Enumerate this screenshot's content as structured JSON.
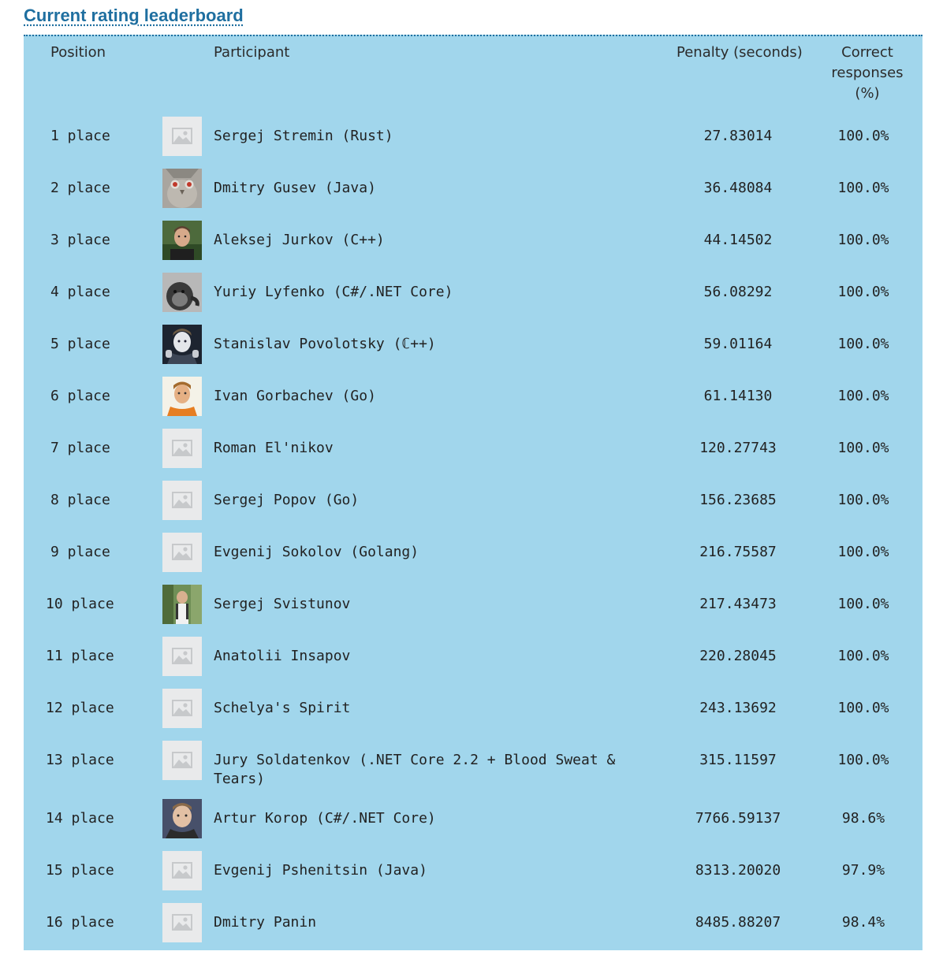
{
  "title": "Current rating leaderboard",
  "columns": {
    "position": "Position",
    "participant": "Participant",
    "penalty": "Penalty (seconds)",
    "correct_l1": "Correct",
    "correct_l2": "responses",
    "correct_l3": "(%)"
  },
  "rows": [
    {
      "position": "1 place",
      "name": "Sergej Stremin (Rust)",
      "penalty": "27.83014",
      "correct": "100.0%",
      "avatar": "placeholder"
    },
    {
      "position": "2 place",
      "name": "Dmitry Gusev (Java)",
      "penalty": "36.48084",
      "correct": "100.0%",
      "avatar": "owl"
    },
    {
      "position": "3 place",
      "name": "Aleksej Jurkov (C++)",
      "penalty": "44.14502",
      "correct": "100.0%",
      "avatar": "man-outdoor"
    },
    {
      "position": "4 place",
      "name": "Yuriy Lyfenko (C#/.NET Core)",
      "penalty": "56.08292",
      "correct": "100.0%",
      "avatar": "monkey"
    },
    {
      "position": "5 place",
      "name": "Stanislav Povolotsky (ℂ++)",
      "penalty": "59.01164",
      "correct": "100.0%",
      "avatar": "man-dark"
    },
    {
      "position": "6 place",
      "name": "Ivan Gorbachev (Go)",
      "penalty": "61.14130",
      "correct": "100.0%",
      "avatar": "man-orange"
    },
    {
      "position": "7 place",
      "name": "Roman El'nikov",
      "penalty": "120.27743",
      "correct": "100.0%",
      "avatar": "placeholder"
    },
    {
      "position": "8 place",
      "name": "Sergej Popov (Go)",
      "penalty": "156.23685",
      "correct": "100.0%",
      "avatar": "placeholder"
    },
    {
      "position": "9 place",
      "name": "Evgenij Sokolov (Golang)",
      "penalty": "216.75587",
      "correct": "100.0%",
      "avatar": "placeholder"
    },
    {
      "position": "10 place",
      "name": "Sergej Svistunov",
      "penalty": "217.43473",
      "correct": "100.0%",
      "avatar": "man-trees"
    },
    {
      "position": "11 place",
      "name": "Anatolii Insapov",
      "penalty": "220.28045",
      "correct": "100.0%",
      "avatar": "placeholder"
    },
    {
      "position": "12 place",
      "name": "Schelya's Spirit",
      "penalty": "243.13692",
      "correct": "100.0%",
      "avatar": "placeholder"
    },
    {
      "position": "13 place",
      "name": "Jury Soldatenkov (.NET Core 2.2 + Blood Sweat & Tears)",
      "penalty": "315.11597",
      "correct": "100.0%",
      "avatar": "placeholder"
    },
    {
      "position": "14 place",
      "name": "Artur Korop (C#/.NET Core)",
      "penalty": "7766.59137",
      "correct": "98.6%",
      "avatar": "man-light"
    },
    {
      "position": "15 place",
      "name": "Evgenij Pshenitsin (Java)",
      "penalty": "8313.20020",
      "correct": "97.9%",
      "avatar": "placeholder"
    },
    {
      "position": "16 place",
      "name": "Dmitry Panin",
      "penalty": "8485.88207",
      "correct": "98.4%",
      "avatar": "placeholder"
    }
  ]
}
